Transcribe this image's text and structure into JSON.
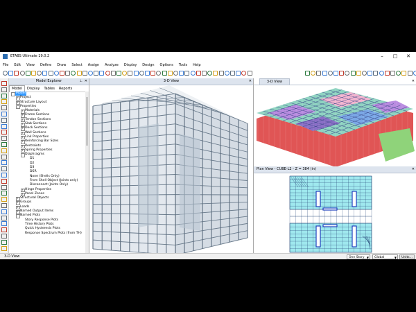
{
  "window": {
    "title": "ETABS Ultimate 19.0.2",
    "minimize_icon": "minimize-icon",
    "maximize_icon": "maximize-icon",
    "close_icon": "close-icon"
  },
  "menu": [
    "File",
    "Edit",
    "View",
    "Define",
    "Draw",
    "Select",
    "Assign",
    "Analyze",
    "Display",
    "Design",
    "Options",
    "Tools",
    "Help"
  ],
  "explorer": {
    "title": "Model Explorer",
    "tabs": [
      "Model",
      "Display",
      "Tables",
      "Reports"
    ],
    "tree": [
      {
        "label": "Model",
        "level": 0,
        "toggle": "-",
        "selected": true
      },
      {
        "label": "Project",
        "level": 1,
        "toggle": "+"
      },
      {
        "label": "Structure Layout",
        "level": 1,
        "toggle": "+"
      },
      {
        "label": "Properties",
        "level": 1,
        "toggle": "-"
      },
      {
        "label": "Materials",
        "level": 2,
        "toggle": "+"
      },
      {
        "label": "Frame Sections",
        "level": 2,
        "toggle": "+"
      },
      {
        "label": "Tendon Sections",
        "level": 2,
        "toggle": "+"
      },
      {
        "label": "Slab Sections",
        "level": 2,
        "toggle": "+"
      },
      {
        "label": "Deck Sections",
        "level": 2,
        "toggle": "+"
      },
      {
        "label": "Wall Sections",
        "level": 2,
        "toggle": "+"
      },
      {
        "label": "Link Properties",
        "level": 2,
        "toggle": "+"
      },
      {
        "label": "Reinforcing Bar Sizes",
        "level": 2,
        "toggle": "+"
      },
      {
        "label": "Restraints",
        "level": 2,
        "toggle": "+"
      },
      {
        "label": "Spring Properties",
        "level": 2,
        "toggle": "+"
      },
      {
        "label": "Diaphragms",
        "level": 2,
        "toggle": "-"
      },
      {
        "label": "D1",
        "level": 3,
        "toggle": ""
      },
      {
        "label": "D2",
        "level": 3,
        "toggle": ""
      },
      {
        "label": "D3",
        "level": 3,
        "toggle": ""
      },
      {
        "label": "DSR",
        "level": 3,
        "toggle": ""
      },
      {
        "label": "None (Shells Only)",
        "level": 3,
        "toggle": ""
      },
      {
        "label": "From Shell Object (Joints only)",
        "level": 3,
        "toggle": ""
      },
      {
        "label": "Disconnect (Joints Only)",
        "level": 3,
        "toggle": ""
      },
      {
        "label": "Hinge Properties",
        "level": 2,
        "toggle": "+"
      },
      {
        "label": "Panel Zones",
        "level": 2,
        "toggle": "+"
      },
      {
        "label": "Structural Objects",
        "level": 1,
        "toggle": "+"
      },
      {
        "label": "Groups",
        "level": 1,
        "toggle": "+"
      },
      {
        "label": "Loads",
        "level": 1,
        "toggle": "+"
      },
      {
        "label": "Named Output Items",
        "level": 1,
        "toggle": "+"
      },
      {
        "label": "Named Plots",
        "level": 1,
        "toggle": "-"
      },
      {
        "label": "Story Response Plots",
        "level": 2,
        "toggle": ""
      },
      {
        "label": "Time History Plots",
        "level": 2,
        "toggle": ""
      },
      {
        "label": "Quick Hysteresis Plots",
        "level": 2,
        "toggle": ""
      },
      {
        "label": "Response Spectrum Plots (from TH)",
        "level": 2,
        "toggle": ""
      }
    ]
  },
  "views": {
    "center_title": "3-D View",
    "top_right_title": "3-D View",
    "bottom_right_title": "Plan View - CUBE-L2 - Z = 384 (in)"
  },
  "status": {
    "left_text": "3-D View",
    "story_select": "One Story",
    "coord_select": "Global",
    "units_button": "Units..."
  },
  "colors": {
    "selection": "#3399ff",
    "panel_header": "#dde4ee",
    "steel_frame": "#6a7b8c",
    "plan_fill": "#9fe8ee"
  }
}
